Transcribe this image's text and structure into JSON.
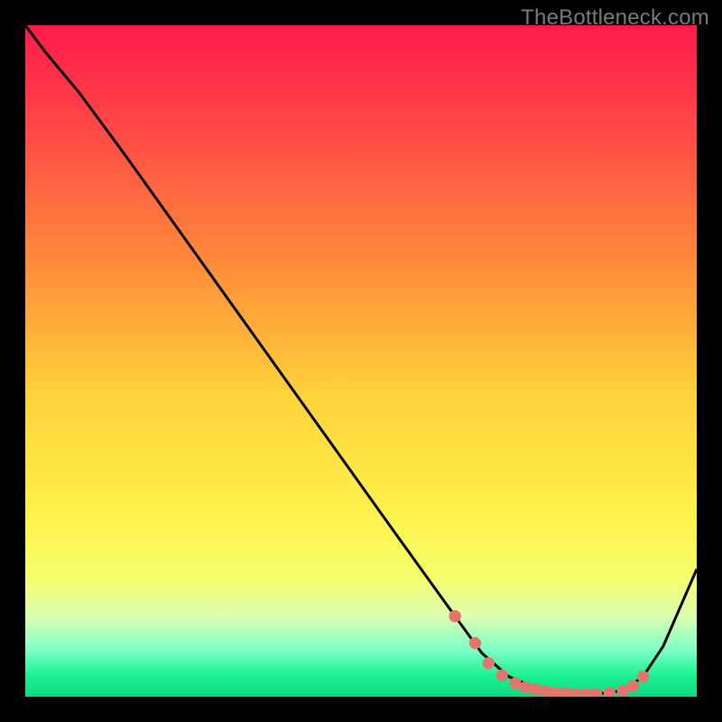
{
  "watermark": "TheBottleneck.com",
  "chart_data": {
    "type": "line",
    "title": "",
    "xlabel": "",
    "ylabel": "",
    "xlim": [
      0,
      100
    ],
    "ylim": [
      0,
      100
    ],
    "grid": false,
    "legend": false,
    "gradient_stops": [
      {
        "offset": 0.0,
        "color": "#ff1a4b"
      },
      {
        "offset": 0.15,
        "color": "#ff4747"
      },
      {
        "offset": 0.35,
        "color": "#ff8a3a"
      },
      {
        "offset": 0.55,
        "color": "#ffd23a"
      },
      {
        "offset": 0.72,
        "color": "#fff04a"
      },
      {
        "offset": 0.82,
        "color": "#f7ff6a"
      },
      {
        "offset": 0.88,
        "color": "#dcffb0"
      },
      {
        "offset": 0.93,
        "color": "#7effc7"
      },
      {
        "offset": 0.97,
        "color": "#1af090"
      },
      {
        "offset": 1.0,
        "color": "#0fd884"
      }
    ],
    "series": [
      {
        "name": "curve",
        "color": "#000000",
        "x": [
          0.0,
          3.0,
          8.0,
          15.0,
          25.0,
          40.0,
          55.0,
          64.0,
          68.0,
          72.0,
          76.0,
          80.0,
          85.0,
          89.0,
          92.0,
          95.0,
          100.0
        ],
        "y": [
          100.0,
          96.0,
          90.0,
          80.5,
          66.5,
          45.5,
          24.5,
          12.0,
          6.5,
          3.0,
          1.3,
          0.6,
          0.4,
          0.9,
          3.0,
          7.5,
          19.0
        ]
      }
    ],
    "markers": {
      "name": "dots",
      "color": "#e2766d",
      "radius_pct": 0.9,
      "x": [
        64.0,
        67.0,
        69.0,
        71.0,
        73.0,
        74.5,
        76.0,
        77.5,
        79.0,
        80.5,
        82.0,
        83.5,
        85.0,
        87.0,
        89.0,
        90.5,
        92.0
      ],
      "y": [
        12.0,
        8.0,
        5.0,
        3.2,
        2.0,
        1.4,
        1.1,
        0.8,
        0.6,
        0.5,
        0.4,
        0.4,
        0.4,
        0.6,
        0.9,
        1.6,
        3.0
      ]
    }
  }
}
